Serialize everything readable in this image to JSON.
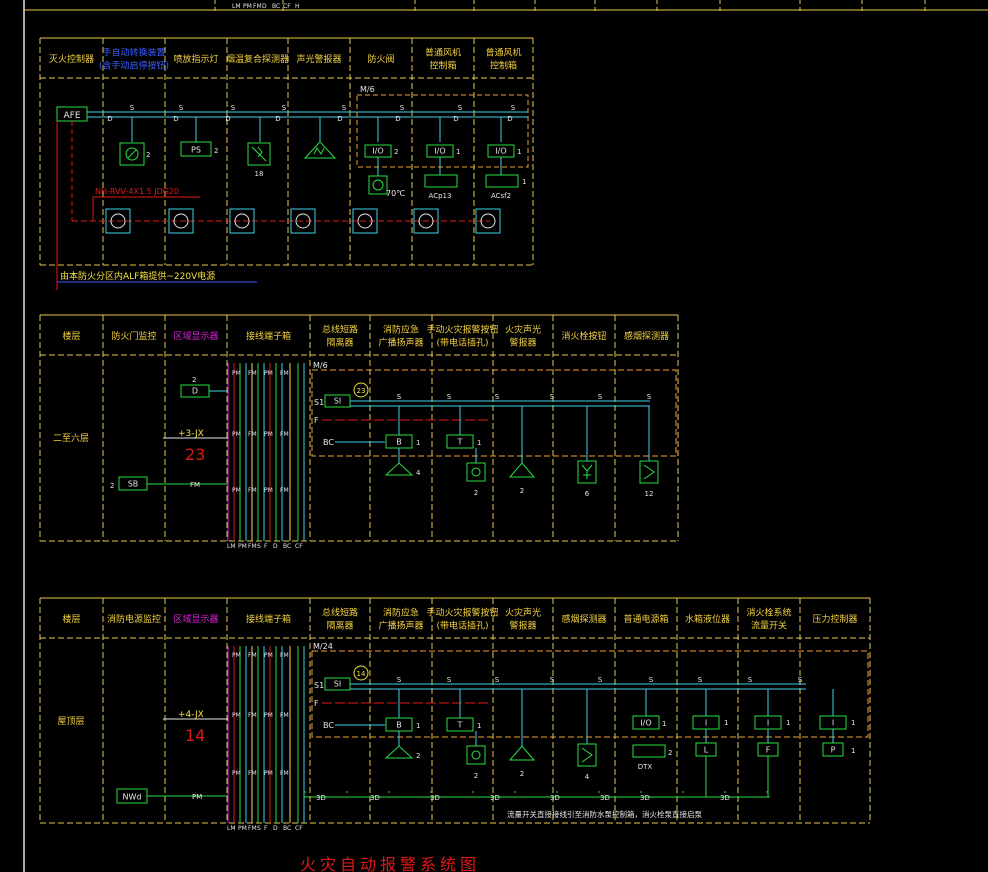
{
  "colors": {
    "background": "#000000",
    "grid": "#e8c84a",
    "header_text": "#f2d040",
    "cyan": "#3fd0e6",
    "green": "#28e040",
    "red": "#e01818",
    "magenta": "#e020e0",
    "white": "#e6e6e6",
    "orange": "#f0a030",
    "blue": "#3a5cff",
    "yellow": "#f0e040"
  },
  "top_fragment": {
    "labels": [
      "LM",
      "PM",
      "FM",
      "D",
      "BC",
      "CF",
      "H"
    ]
  },
  "section1": {
    "headers": [
      {
        "text": "灭火控制器",
        "color": "header_text"
      },
      {
        "text": "手自动转换装置\n(含手动启停按钮)",
        "color": "blue"
      },
      {
        "text": "喷放指示灯",
        "color": "header_text"
      },
      {
        "text": "烟温复合探测器",
        "color": "header_text"
      },
      {
        "text": "声光警报器",
        "color": "header_text"
      },
      {
        "text": "防火阀",
        "color": "header_text"
      },
      {
        "text": "普通风机\n控制箱",
        "color": "header_text"
      },
      {
        "text": "普通风机\n控制箱",
        "color": "header_text"
      }
    ],
    "afe": "AFE",
    "bus_label": "M/6",
    "cable_label": "NH-RVV-4X1.5 JDG20",
    "power_note": "由本防火分区内ALF箱提供~220V电源",
    "device_labels": {
      "manual_count": "2",
      "ps": "PS",
      "ps_count": "2",
      "detector_count": "18",
      "io1": "I/O",
      "io1_count": "2",
      "io2": "I/O",
      "io2_count": "1",
      "io3": "I/O",
      "io3_count": "1",
      "valve_temp": "70℃",
      "fan1": "ACp13",
      "fan2": "ACsf2",
      "s": "S",
      "d": "D"
    }
  },
  "section2": {
    "headers": [
      {
        "text": "楼层",
        "color": "header_text"
      },
      {
        "text": "防火门监控",
        "color": "header_text"
      },
      {
        "text": "区域显示器",
        "color": "magenta"
      },
      {
        "text": "接线端子箱",
        "color": "header_text"
      },
      {
        "text": "总线短路\n隔离器",
        "color": "header_text"
      },
      {
        "text": "消防应急\n广播扬声器",
        "color": "header_text"
      },
      {
        "text": "手动火灾报警按钮\n(带电话插孔)",
        "color": "header_text"
      },
      {
        "text": "火灾声光\n警报器",
        "color": "header_text"
      },
      {
        "text": "消火栓按钮",
        "color": "header_text"
      },
      {
        "text": "感烟探测器",
        "color": "header_text"
      }
    ],
    "floor": "二至六层",
    "d_box": "D",
    "d_count": "2",
    "jx_label": "+3-JX",
    "jx_number": "23",
    "sb_box": "SB",
    "sb_count": "2",
    "fm": "FM",
    "bus_label": "M/6",
    "circle_num": "23",
    "si": "SI",
    "s1": "S1",
    "f": "F",
    "bc": "BC",
    "b_box": "B",
    "b_count": "1",
    "t_box": "T",
    "t_count": "1",
    "speaker_count": "4",
    "manual_count": "2",
    "alarm_count": "2",
    "hydrant_count": "6",
    "smoke_count": "12",
    "bottom_labels": [
      "LM",
      "PM",
      "FM",
      "S",
      "F",
      "D",
      "BC",
      "CF"
    ]
  },
  "section3": {
    "headers": [
      {
        "text": "楼层",
        "color": "header_text"
      },
      {
        "text": "消防电源监控",
        "color": "header_text"
      },
      {
        "text": "区域显示器",
        "color": "magenta"
      },
      {
        "text": "接线端子箱",
        "color": "header_text"
      },
      {
        "text": "总线短路\n隔离器",
        "color": "header_text"
      },
      {
        "text": "消防应急\n广播扬声器",
        "color": "header_text"
      },
      {
        "text": "手动火灾报警按钮\n(带电话插孔)",
        "color": "header_text"
      },
      {
        "text": "火灾声光\n警报器",
        "color": "header_text"
      },
      {
        "text": "感烟探测器",
        "color": "header_text"
      },
      {
        "text": "普通电源箱",
        "color": "header_text"
      },
      {
        "text": "水箱液位器",
        "color": "header_text"
      },
      {
        "text": "消火栓系统\n流量开关",
        "color": "header_text"
      },
      {
        "text": "压力控制器",
        "color": "header_text"
      }
    ],
    "floor": "屋顶层",
    "jx_label": "+4-JX",
    "jx_number": "14",
    "nwd_box": "NWd",
    "pm": "PM",
    "bus_label": "M/24",
    "circle_num": "14",
    "si": "SI",
    "s1": "S1",
    "f": "F",
    "bc": "BC",
    "b_box": "B",
    "b_count": "1",
    "t_box": "T",
    "t_count": "1",
    "speaker_count": "2",
    "manual_count": "2",
    "alarm_count": "2",
    "smoke_count": "4",
    "io_box": "I/O",
    "io_count": "1",
    "dtx": "DTX",
    "i1": "I",
    "i1_count": "1",
    "i2": "I",
    "i2_count": "1",
    "i3": "I",
    "i3_count": "1",
    "l_box": "L",
    "f_box": "F",
    "p_box": "P",
    "p_count": "1",
    "power_bus": "3D",
    "note": "流量开关直接接线引至消防水泵控制箱，消火栓泵直接启泵",
    "bottom_labels": [
      "LM",
      "PM",
      "FM",
      "S",
      "F",
      "D",
      "BC",
      "CF"
    ]
  },
  "footer_title": "火灾自动报警系统图"
}
